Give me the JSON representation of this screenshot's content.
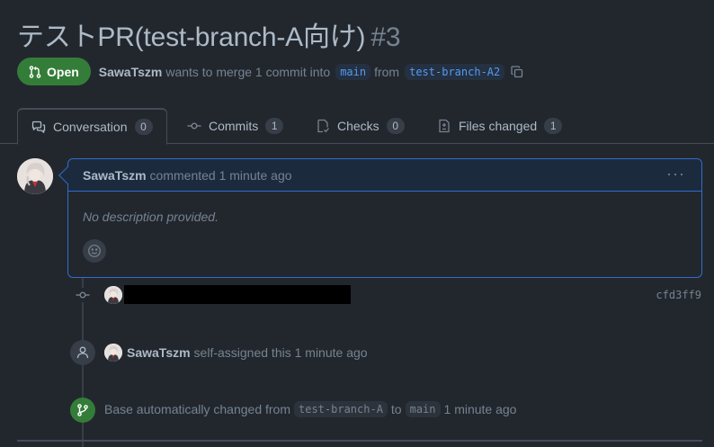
{
  "pr": {
    "title": "テストPR(test-branch-A向け)",
    "number": "#3",
    "state": "Open",
    "author": "SawaTszm",
    "merge_text": "wants to merge 1 commit into",
    "base_branch": "main",
    "from_text": "from",
    "head_branch": "test-branch-A2"
  },
  "tabs": [
    {
      "label": "Conversation",
      "count": "0",
      "icon": "conversation-icon"
    },
    {
      "label": "Commits",
      "count": "1",
      "icon": "commit-icon"
    },
    {
      "label": "Checks",
      "count": "0",
      "icon": "checks-icon"
    },
    {
      "label": "Files changed",
      "count": "1",
      "icon": "file-diff-icon"
    }
  ],
  "comment": {
    "author": "SawaTszm",
    "action": "commented 1 minute ago",
    "body": "No description provided.",
    "menu_glyph": "···"
  },
  "timeline": {
    "commit": {
      "sha": "cfd3ff9",
      "message_redacted": true
    },
    "assign": {
      "author": "SawaTszm",
      "text": "self-assigned this 1 minute ago"
    },
    "base_change": {
      "prefix": "Base automatically changed from",
      "from_branch": "test-branch-A",
      "to_text": "to",
      "to_branch": "main",
      "time": "1 minute ago"
    }
  },
  "colors": {
    "background": "#22272e",
    "open_green": "#347d39",
    "link_blue": "#539bf5",
    "comment_border": "#316dca"
  }
}
